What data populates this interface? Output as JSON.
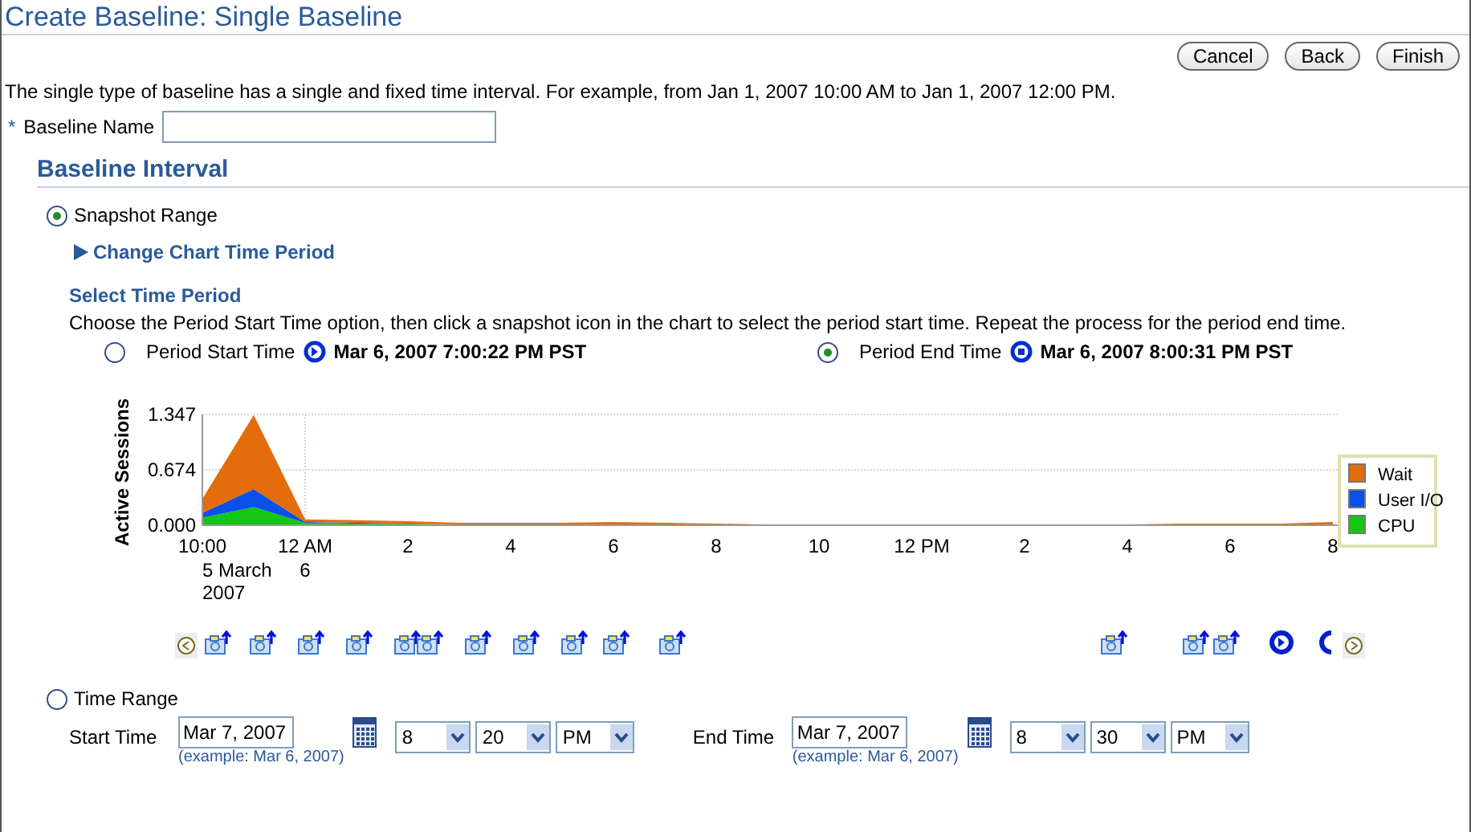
{
  "title": "Create Baseline: Single Baseline",
  "buttons": [
    "Cancel",
    "Back",
    "Finish"
  ],
  "description": "The single type of baseline has a single and fixed time interval. For example, from Jan 1, 2007 10:00 AM to Jan 1, 2007 12:00 PM.",
  "baseline_name": {
    "required_mark": "*",
    "label": "Baseline Name"
  },
  "section_title": "Baseline Interval",
  "snapshot_range": {
    "label": "Snapshot Range",
    "selected": true
  },
  "change_chart_link": "Change Chart Time Period",
  "select_time_period": {
    "title": "Select Time Period",
    "instructions": "Choose the Period Start Time option, then click a snapshot icon in the chart to select the period start time. Repeat the process for the period end time."
  },
  "period_options": [
    {
      "label": "Period Start Time",
      "value": "Mar 6, 2007 7:00:22 PM PST",
      "selected": false,
      "kind": "start"
    },
    {
      "label": "Period End Time",
      "value": "Mar 6, 2007 8:00:31 PM PST",
      "selected": true,
      "kind": "end"
    }
  ],
  "chart_data": {
    "type": "area",
    "stacked": true,
    "ylabel": "Active Sessions",
    "categories": [
      "10:00",
      null,
      "12 AM",
      null,
      "2",
      null,
      "4",
      null,
      "6",
      null,
      "8",
      null,
      "10",
      null,
      "12 PM",
      null,
      "2",
      null,
      "4",
      null,
      "6",
      null,
      "8"
    ],
    "series": [
      {
        "name": "Wait",
        "color": "#e46c0a",
        "values": [
          0.17,
          0.9,
          0.03,
          0.03,
          0.03,
          0.02,
          0.02,
          0.02,
          0.03,
          0.02,
          0.02,
          0.01,
          0.0,
          0.0,
          0.0,
          0.0,
          0.0,
          0.0,
          0.01,
          0.02,
          0.02,
          0.02,
          0.03
        ]
      },
      {
        "name": "User I/O",
        "color": "#0b50e8",
        "values": [
          0.06,
          0.22,
          0.01,
          0.01,
          0.0,
          0.0,
          0.0,
          0.0,
          0.0,
          0.0,
          0.0,
          0.0,
          0.0,
          0.0,
          0.0,
          0.0,
          0.0,
          0.0,
          0.0,
          0.0,
          0.0,
          0.0,
          0.0
        ]
      },
      {
        "name": "CPU",
        "color": "#12c812",
        "values": [
          0.09,
          0.22,
          0.03,
          0.02,
          0.02,
          0.01,
          0.01,
          0.01,
          0.01,
          0.01,
          0.0,
          0.0,
          0.0,
          0.0,
          0.0,
          0.0,
          0.0,
          0.0,
          0.0,
          0.0,
          0.0,
          0.0,
          0.01
        ]
      }
    ],
    "yticks": [
      {
        "value": 0,
        "label": "0.000"
      },
      {
        "value": 0.674,
        "label": "0.674"
      },
      {
        "value": 1.347,
        "label": "1.347"
      }
    ],
    "ylim": [
      0,
      1.347
    ],
    "legend": "right"
  },
  "x_date_labels": [
    {
      "lines": [
        "5 March",
        "2007"
      ]
    },
    {
      "lines": [
        "6"
      ]
    }
  ],
  "time_range": {
    "label": "Time Range",
    "selected": false
  },
  "range_rows": [
    {
      "label": "Start Time",
      "date": "Mar 7, 2007",
      "example": "(example: Mar 6, 2007)",
      "hour": "8",
      "minute": "20",
      "ampm": "PM"
    },
    {
      "label": "End Time",
      "date": "Mar 7, 2007",
      "example": "(example: Mar 6, 2007)",
      "hour": "8",
      "minute": "30",
      "ampm": "PM"
    }
  ]
}
